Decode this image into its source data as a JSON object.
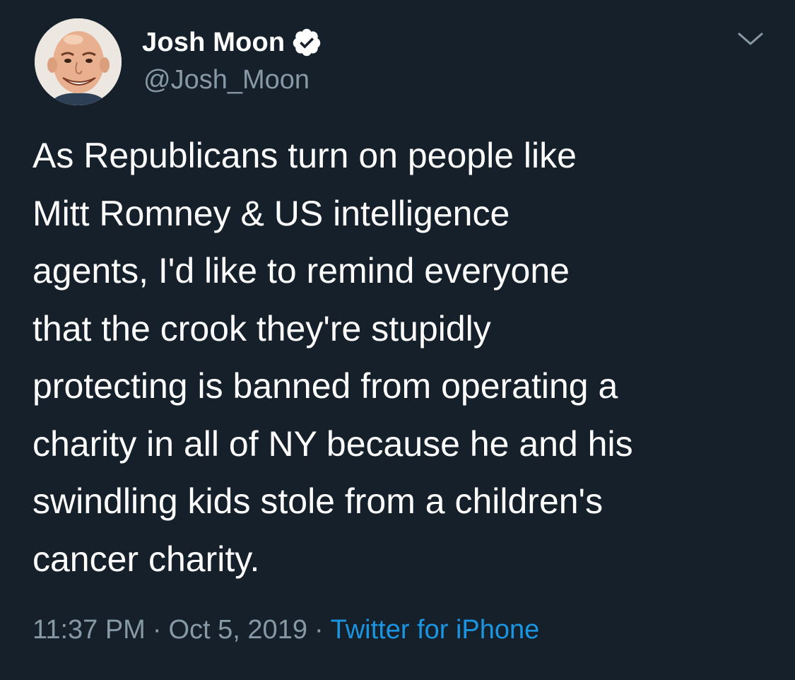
{
  "author": {
    "display_name": "Josh Moon",
    "handle": "@Josh_Moon",
    "verified": true
  },
  "tweet": {
    "lines": [
      "As Republicans turn on people like",
      "Mitt Romney & US intelligence",
      "agents, I'd like to remind everyone",
      "that the crook they're stupidly",
      "protecting is banned from operating a",
      "charity in all of NY because he and his",
      "swindling kids stole from a children's",
      "cancer charity."
    ],
    "time": "11:37 PM",
    "date": "Oct 5, 2019",
    "separator": "·",
    "source": "Twitter for iPhone"
  },
  "icons": {
    "verified": "verified-badge-icon",
    "menu": "chevron-down-icon"
  },
  "colors": {
    "background": "#15202b",
    "text_primary": "#ffffff",
    "text_secondary": "#8899a6",
    "accent": "#1b95e0"
  }
}
